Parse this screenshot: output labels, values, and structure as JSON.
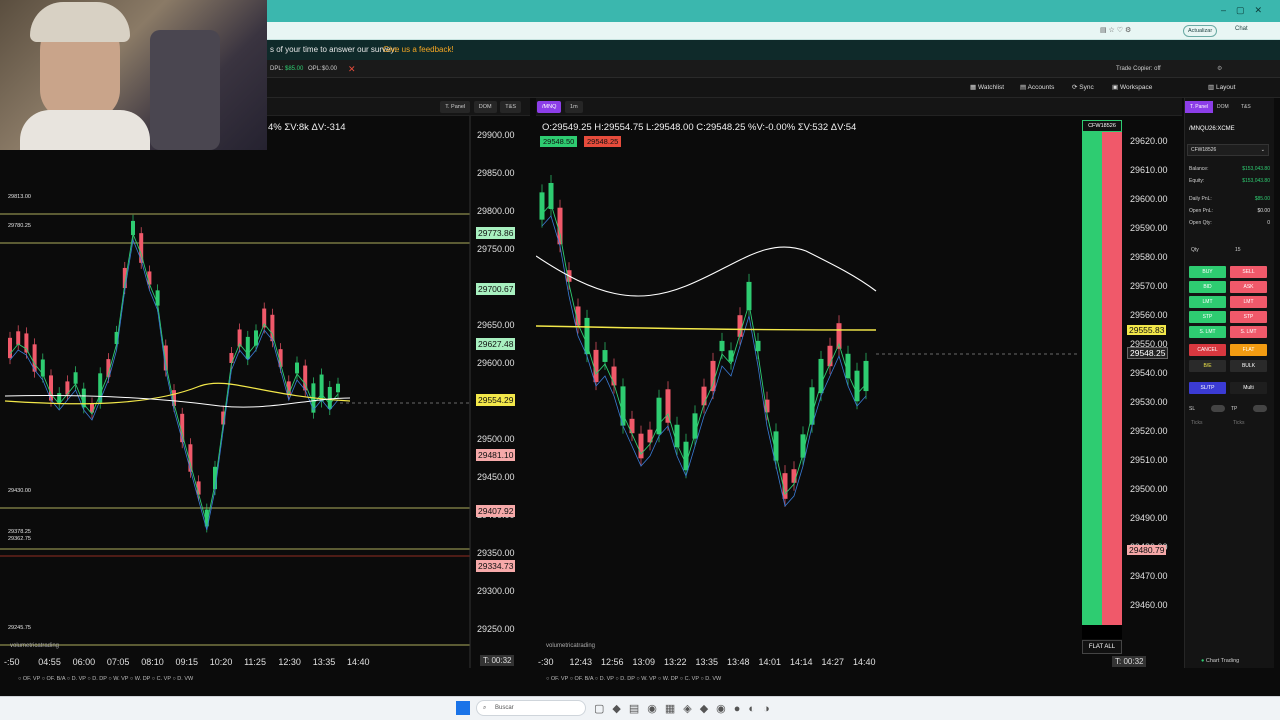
{
  "survey": {
    "text": "s of your time to answer our survey:",
    "link": "Give us a feedback!"
  },
  "toolbar": {
    "dpl_label": "DPL:",
    "dpl_value": "$85.00",
    "opl_label": "OPL:",
    "opl_value": "$0.00",
    "trade_copier": "Trade Copier: off",
    "layout": "Layout",
    "update_btn": "Actualizar",
    "chat": "Chat"
  },
  "nav": {
    "watchlist": "Watchlist",
    "accounts": "Accounts",
    "sync": "Sync",
    "workspace": "Workspace"
  },
  "left_chart": {
    "tabs": [
      "T. Panel",
      "DOM",
      "T&S"
    ],
    "stats": "4%  ΣV:8k  ΔV:-314",
    "price_scale": [
      "29900.00",
      "29850.00",
      "29800.00",
      "29750.00",
      "29700.00",
      "29650.00",
      "29600.00",
      "29550.00",
      "29500.00",
      "29450.00",
      "29400.00",
      "29350.00",
      "29300.00",
      "29250.00"
    ],
    "tags": [
      {
        "text": "29773.86",
        "color": "#a8f0c0"
      },
      {
        "text": "29700.67",
        "color": "#a8f0c0"
      },
      {
        "text": "29627.48",
        "color": "#a8f0c0"
      },
      {
        "text": "29554.29",
        "color": "#f3e84a"
      },
      {
        "text": "29481.10",
        "color": "#f6a9a9"
      },
      {
        "text": "29407.92",
        "color": "#f6a9a9"
      },
      {
        "text": "29334.73",
        "color": "#f6a9a9"
      }
    ],
    "hlines": [
      "29813.00",
      "29780.25",
      "29430.00",
      "29378.25",
      "29362.75",
      "29245.75"
    ],
    "times": [
      "-:50",
      "04:55",
      "06:00",
      "07:05",
      "08:10",
      "09:15",
      "10:20",
      "11:25",
      "12:30",
      "13:35",
      "14:40"
    ],
    "timer": "T: 00:32",
    "brand": "volumetricatrading",
    "bottom_tools": [
      "OF. VP",
      "OF. B/A",
      "D. VP",
      "D. DP",
      "W. VP",
      "W. DP",
      "C. VP",
      "D. VW"
    ]
  },
  "right_chart": {
    "symbol_tab": "/MNQ",
    "interval_tab": "1m",
    "tabs": [
      "T. Panel",
      "DOM",
      "T&S"
    ],
    "ohlc": "O:29549.25  H:29554.75  L:29548.00  C:29548.25  %V:-0.00%  ΣV:532  ΔV:54",
    "bid_tag": "29548.50",
    "ask_tag": "29548.25",
    "price_scale": [
      "29620.00",
      "29610.00",
      "29600.00",
      "29590.00",
      "29580.00",
      "29570.00",
      "29560.00",
      "29550.00",
      "29540.00",
      "29530.00",
      "29520.00",
      "29510.00",
      "29500.00",
      "29490.00",
      "29480.00",
      "29470.00",
      "29460.00"
    ],
    "tag_yellow": "29555.83",
    "tag_current": "29548.25",
    "tag_red": "29480.79",
    "account_badge": "CFW18526",
    "flat_all": "FLAT ALL",
    "times": [
      "-:30",
      "12:43",
      "12:56",
      "13:09",
      "13:22",
      "13:35",
      "13:48",
      "14:01",
      "14:14",
      "14:27",
      "14:40"
    ],
    "timer": "T: 00:32",
    "brand": "volumetricatrading",
    "bottom_tools": [
      "OF. VP",
      "OF. B/A",
      "D. VP",
      "D. DP",
      "W. VP",
      "W. DP",
      "C. VP",
      "D. VW"
    ]
  },
  "sidebar": {
    "symbol": "/MNQU26:XCME",
    "account": "CFW18526",
    "balance_label": "Balance:",
    "balance_value": "$153,043.80",
    "equity_label": "Equity:",
    "equity_value": "$153,043.80",
    "daily_pnl_label": "Daily PnL:",
    "daily_pnl_value": "$85.00",
    "open_pnl_label": "Open PnL:",
    "open_pnl_value": "$0.00",
    "open_qty_label": "Open Qty:",
    "open_qty_value": "0",
    "qty_label": "Qty",
    "qty_value": "15",
    "buttons": {
      "buy": "BUY",
      "sell": "SELL",
      "bid": "BID",
      "ask": "ASK",
      "lmt_buy": "LMT",
      "lmt_sell": "LMT",
      "stp_buy": "STP",
      "stp_sell": "STP",
      "slmt_buy": "S. LMT",
      "slmt_sell": "S. LMT",
      "cancel": "CANCEL",
      "flat": "FLAT",
      "be": "B/E",
      "bulk": "BULK",
      "sltp": "SL/TP",
      "multi": "Multi"
    },
    "sl_label": "SL",
    "tp_label": "TP",
    "ticks_label": "Ticks",
    "chart_trading": "Chart Trading"
  },
  "taskbar": {
    "search_placeholder": "Buscar"
  }
}
